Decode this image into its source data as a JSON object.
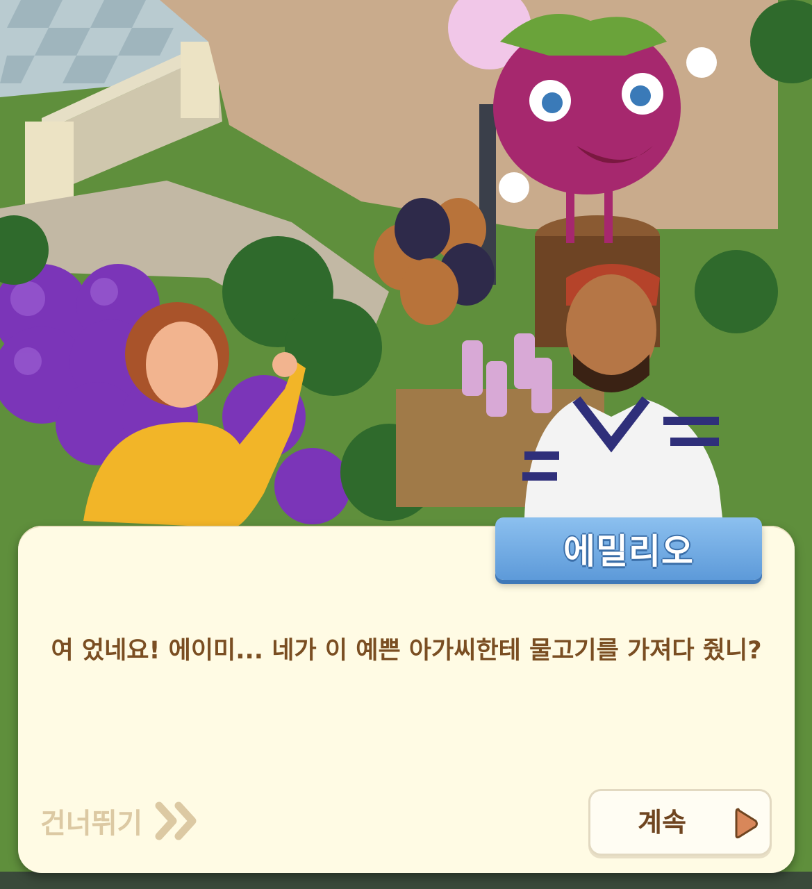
{
  "dialog": {
    "speaker_name": "에밀리오",
    "text": "여  었네요! 에이미... 네가 이 예쁜 아가씨한테 물고기를 가져다 줬니?"
  },
  "controls": {
    "skip_label": "건너뛰기",
    "skip_icon": "double-chevron-right-icon",
    "continue_label": "계속",
    "continue_icon": "play-triangle-icon"
  },
  "colors": {
    "dialog_background": "#fffbe4",
    "dialog_text": "#7a4e22",
    "name_tag": "#5d9ad9",
    "skip_text": "#dcc9a3",
    "continue_arrow": "#d8875a"
  }
}
